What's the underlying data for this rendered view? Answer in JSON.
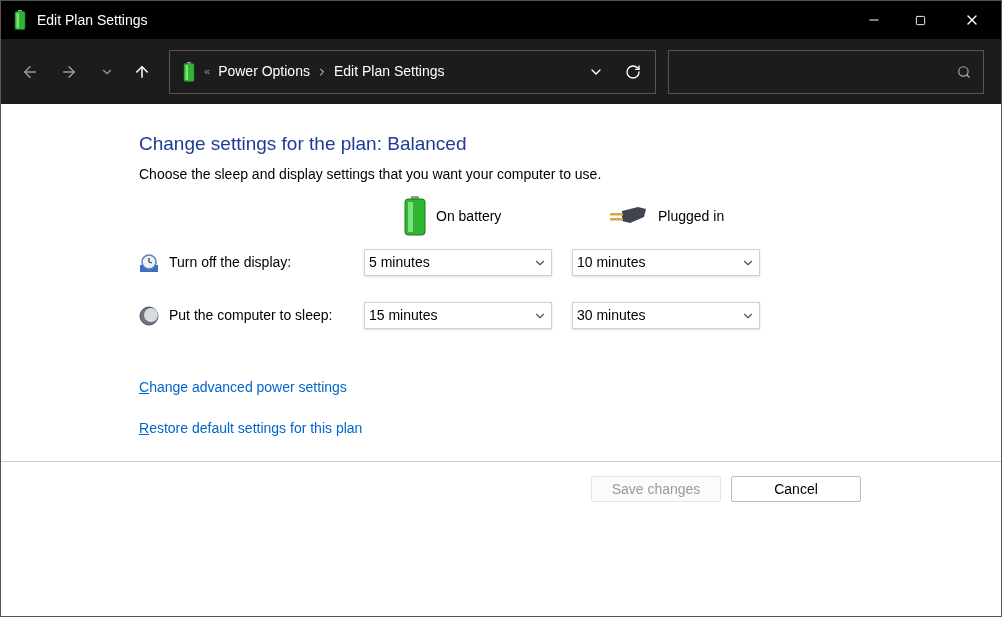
{
  "window": {
    "title": "Edit Plan Settings"
  },
  "breadcrumb": {
    "overflow": "«",
    "items": [
      "Power Options",
      "Edit Plan Settings"
    ]
  },
  "heading": "Change settings for the plan: Balanced",
  "description": "Choose the sleep and display settings that you want your computer to use.",
  "columns": [
    {
      "kind": "battery",
      "label": "On battery"
    },
    {
      "kind": "plug",
      "label": "Plugged in"
    }
  ],
  "settings": [
    {
      "kind": "display",
      "label": "Turn off the display:",
      "values": [
        "5 minutes",
        "10 minutes"
      ]
    },
    {
      "kind": "sleep",
      "label": "Put the computer to sleep:",
      "values": [
        "15 minutes",
        "30 minutes"
      ]
    }
  ],
  "links": [
    "Change advanced power settings",
    "Restore default settings for this plan"
  ],
  "buttons": [
    {
      "label": "Save changes",
      "disabled": true
    },
    {
      "label": "Cancel",
      "disabled": false
    }
  ]
}
